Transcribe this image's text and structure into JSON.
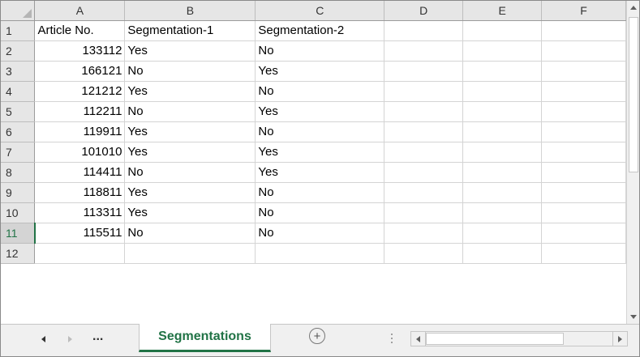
{
  "columns": [
    "A",
    "B",
    "C",
    "D",
    "E",
    "F"
  ],
  "rows": [
    {
      "num": "1",
      "a": "Article No.",
      "b": "Segmentation-1",
      "c": "Segmentation-2"
    },
    {
      "num": "2",
      "a": "133112",
      "b": "Yes",
      "c": "No"
    },
    {
      "num": "3",
      "a": "166121",
      "b": "No",
      "c": "Yes"
    },
    {
      "num": "4",
      "a": "121212",
      "b": "Yes",
      "c": "No"
    },
    {
      "num": "5",
      "a": "112211",
      "b": "No",
      "c": "Yes"
    },
    {
      "num": "6",
      "a": "119911",
      "b": "Yes",
      "c": "No"
    },
    {
      "num": "7",
      "a": "101010",
      "b": "Yes",
      "c": "Yes"
    },
    {
      "num": "8",
      "a": "114411",
      "b": "No",
      "c": "Yes"
    },
    {
      "num": "9",
      "a": "118811",
      "b": "Yes",
      "c": "No"
    },
    {
      "num": "10",
      "a": "113311",
      "b": "Yes",
      "c": "No"
    },
    {
      "num": "11",
      "a": "115511",
      "b": "No",
      "c": "No"
    },
    {
      "num": "12",
      "a": "",
      "b": "",
      "c": ""
    }
  ],
  "active_row": "11",
  "tabs": {
    "ellipsis": "...",
    "active_sheet": "Segmentations",
    "add_sheet": "+"
  },
  "colors": {
    "accent": "#217346",
    "header_bg": "#e6e6e6",
    "gridline": "#d4d4d4"
  }
}
